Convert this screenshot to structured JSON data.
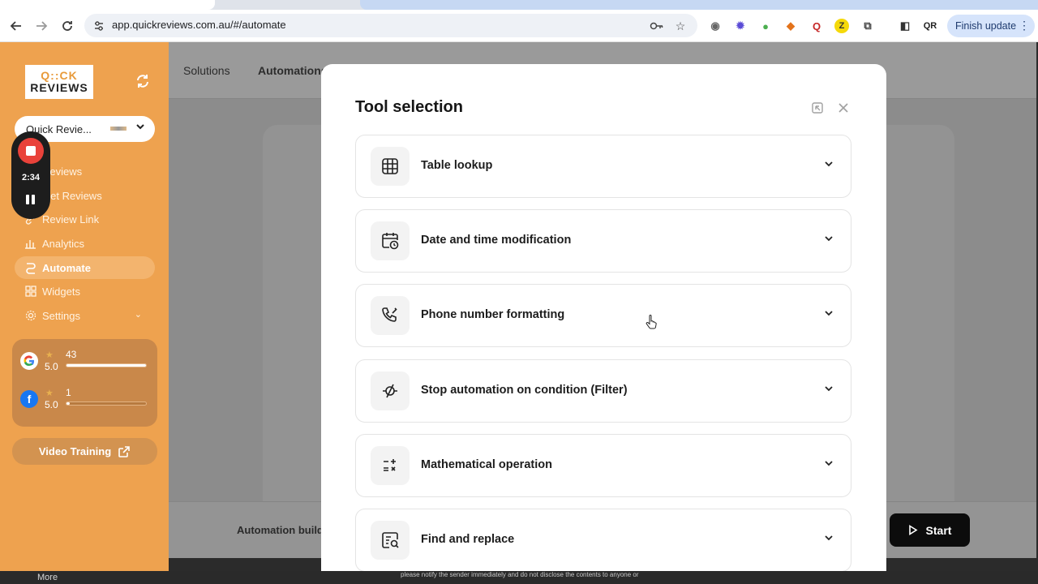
{
  "browser": {
    "url": "app.quickreviews.com.au/#/automate",
    "finish_update_label": "Finish update",
    "nav": {
      "back_icon": "back-arrow-icon",
      "forward_icon": "forward-arrow-icon",
      "reload_icon": "reload-icon"
    }
  },
  "sidebar": {
    "logo": {
      "line1": "Q::CK",
      "line2": "REVIEWS"
    },
    "business_select": {
      "value": "Quick Revie..."
    },
    "items": [
      {
        "label": "Reviews",
        "icon": "star-icon"
      },
      {
        "label": "Get Reviews",
        "icon": "send-icon"
      },
      {
        "label": "Review Link",
        "icon": "link-icon"
      },
      {
        "label": "Analytics",
        "icon": "bar-chart-icon"
      },
      {
        "label": "Automate",
        "icon": "automate-icon",
        "active": true
      },
      {
        "label": "Widgets",
        "icon": "widgets-icon"
      },
      {
        "label": "Settings",
        "icon": "gear-icon"
      }
    ],
    "stats": [
      {
        "platform": "Google",
        "rating": "5.0",
        "count": "43",
        "fill": 1.0
      },
      {
        "platform": "Facebook",
        "rating": "5.0",
        "count": "1",
        "fill": 0.03
      }
    ],
    "video_training_label": "Video Training"
  },
  "recorder": {
    "time": "2:34"
  },
  "main": {
    "tabs": [
      "Solutions",
      "Automations"
    ],
    "bottom_label": "Automation build",
    "start_label": "Start"
  },
  "modal": {
    "title": "Tool selection",
    "tools": [
      {
        "label": "Table lookup",
        "icon": "table-icon"
      },
      {
        "label": "Date and time modification",
        "icon": "calendar-clock-icon"
      },
      {
        "label": "Phone number formatting",
        "icon": "phone-edit-icon"
      },
      {
        "label": "Stop automation on condition (Filter)",
        "icon": "filter-slash-icon"
      },
      {
        "label": "Mathematical operation",
        "icon": "math-operators-icon"
      },
      {
        "label": "Find and replace",
        "icon": "find-replace-icon"
      }
    ]
  },
  "footer": {
    "more_label": "More",
    "notice": "please notify the sender immediately and do not disclose the contents to anyone or"
  },
  "colors": {
    "sidebar": "#eea24f",
    "accent_dark": "#0c0c0c",
    "overlay": "#8c8c8c"
  }
}
